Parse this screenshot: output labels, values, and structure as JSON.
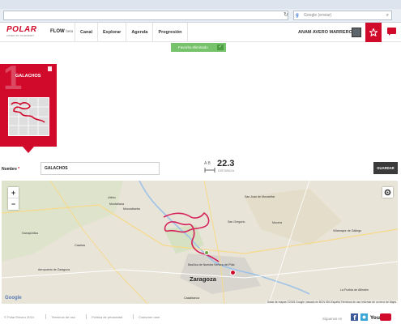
{
  "browser": {
    "search_placeholder": "Google (enviar)"
  },
  "header": {
    "logo_text": "POLAR",
    "logo_tagline": "LISTEN TO YOUR BODY",
    "flow_label": "FLOW",
    "flow_badge": "beta",
    "nav": [
      "Canal",
      "Explorar",
      "Agenda",
      "Progresión"
    ],
    "user_name": "ANAM AVERO MARRERO"
  },
  "toast": {
    "text": "Favorito eliminado"
  },
  "route_card": {
    "number": "1",
    "title": "GALACHOS"
  },
  "form": {
    "name_label": "Nombre",
    "required_mark": "*",
    "name_value": "GALACHOS",
    "ab_label": "A    B",
    "distance_value": "22.3",
    "distance_label": "DISTANCIA",
    "save_label": "GUARDAR"
  },
  "map": {
    "zoom_in": "+",
    "zoom_out": "−",
    "city": "Zaragoza",
    "towns": [
      "Montañana",
      "San Juan de Mozarrifar",
      "San Gregorio",
      "Movera",
      "Villamayor de Gállego",
      "Utebo",
      "Monzalbarba",
      "Garrapinillos",
      "Casetas",
      "Aeropuerto de Zaragoza",
      "Casablanca",
      "Basílica de Nuestra Señora del Pilar",
      "La Puebla de Alfindén"
    ],
    "google_label": "Google",
    "attribution": "Datos de mapas ©2015 Google, basado en BCN IGN España    Términos de uso    Informar de un error de Maps"
  },
  "footer": {
    "links": [
      "© Polar Electro 2014",
      "Términos de uso",
      "Política de privacidad",
      "Customer care"
    ],
    "follow_label": "Síguenos en",
    "social": [
      "facebook-icon",
      "twitter-icon",
      "youtube-icon"
    ]
  },
  "colors": {
    "brand_red": "#d10a2c",
    "toast_green": "#77c36b",
    "route_line": "#d5225a"
  }
}
